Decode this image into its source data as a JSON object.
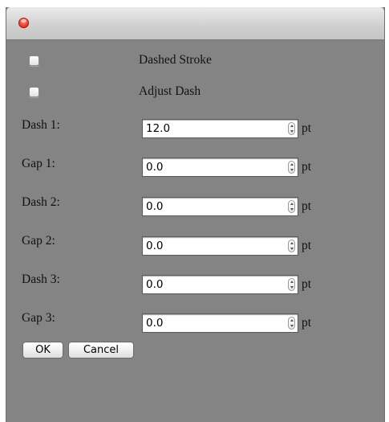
{
  "dialog": {
    "options": {
      "dashed_stroke_label": "Dashed Stroke",
      "dashed_stroke_checked": false,
      "adjust_dash_label": "Adjust Dash",
      "adjust_dash_checked": false
    },
    "fields": [
      {
        "label": "Dash 1:",
        "value": "12.0",
        "unit": "pt"
      },
      {
        "label": "Gap 1:",
        "value": "0.0",
        "unit": "pt"
      },
      {
        "label": "Dash 2:",
        "value": "0.0",
        "unit": "pt"
      },
      {
        "label": "Gap 2:",
        "value": "0.0",
        "unit": "pt"
      },
      {
        "label": "Dash 3:",
        "value": "0.0",
        "unit": "pt"
      },
      {
        "label": "Gap 3:",
        "value": "0.0",
        "unit": "pt"
      }
    ],
    "buttons": {
      "ok_label": "OK",
      "cancel_label": "Cancel"
    }
  }
}
